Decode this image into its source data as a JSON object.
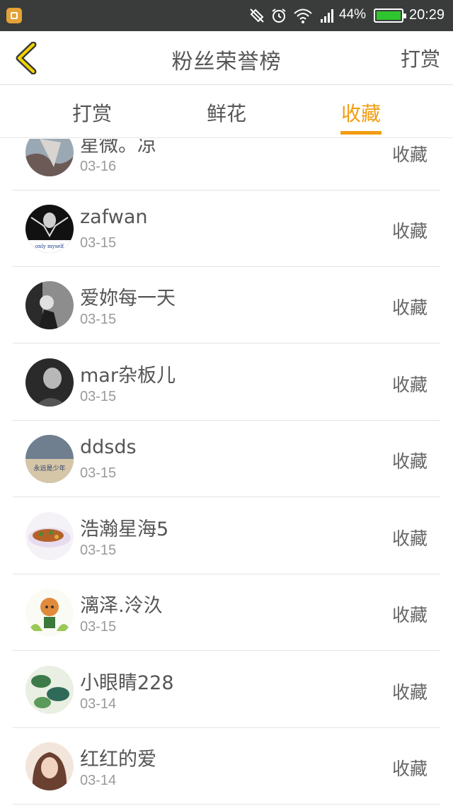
{
  "status_bar": {
    "battery_percent": "44%",
    "time": "20:29",
    "battery_color": "#2ec52e"
  },
  "header": {
    "title": "粉丝荣誉榜",
    "right_link": "打赏",
    "back_icon": "chevron-left-icon"
  },
  "tabs": [
    {
      "label": "打赏",
      "active": false
    },
    {
      "label": "鲜花",
      "active": false
    },
    {
      "label": "收藏",
      "active": true
    }
  ],
  "accent_color": "#f29d12",
  "list": [
    {
      "name": "星微。凉",
      "date": "03-16",
      "action": "收藏"
    },
    {
      "name": "zafwan",
      "date": "03-15",
      "action": "收藏",
      "avatar_text": "only myself"
    },
    {
      "name": "爱妳每一天",
      "date": "03-15",
      "action": "收藏"
    },
    {
      "name": "mar杂板儿",
      "date": "03-15",
      "action": "收藏"
    },
    {
      "name": "ddsds",
      "date": "03-15",
      "action": "收藏",
      "avatar_text": "永远是少年"
    },
    {
      "name": "浩瀚星海5",
      "date": "03-15",
      "action": "收藏"
    },
    {
      "name": "漓泽.泠汣",
      "date": "03-15",
      "action": "收藏"
    },
    {
      "name": "小眼睛228",
      "date": "03-14",
      "action": "收藏"
    },
    {
      "name": "红红的爱",
      "date": "03-14",
      "action": "收藏"
    }
  ]
}
